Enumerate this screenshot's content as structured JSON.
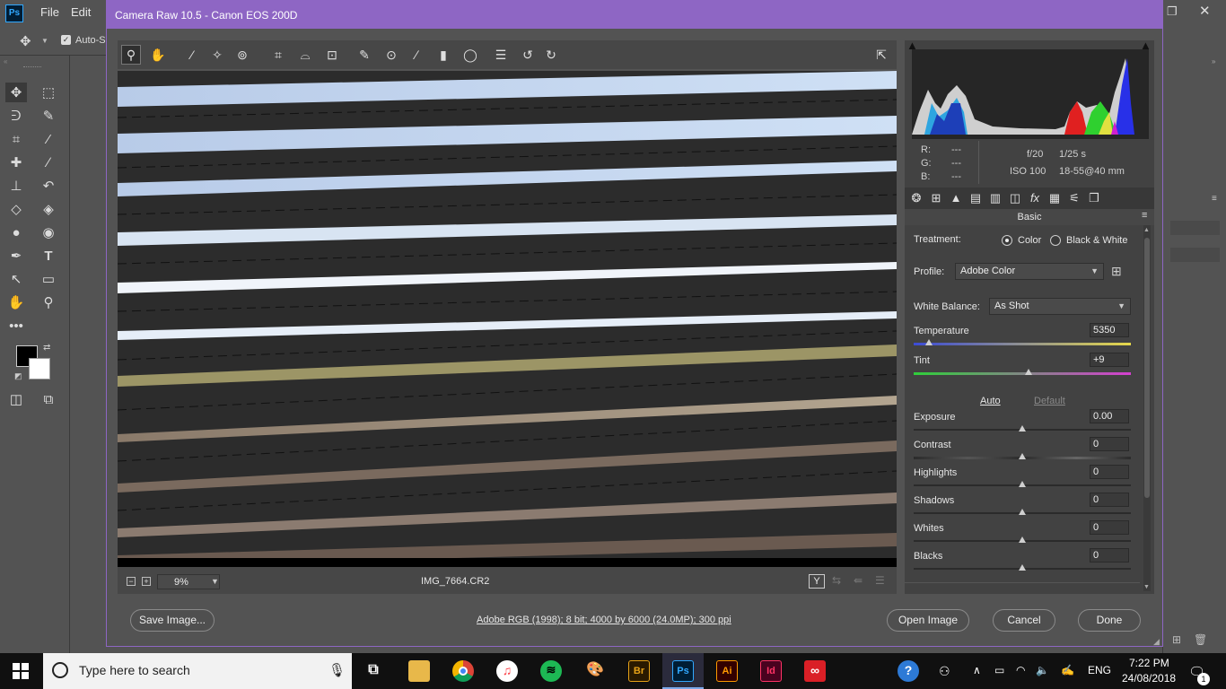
{
  "ps": {
    "logo": "Ps",
    "menus": [
      "File",
      "Edit"
    ],
    "options_label": "Auto-Se"
  },
  "acr": {
    "title": "Camera Raw 10.5  -  Canon EOS 200D",
    "readout": {
      "r_label": "R:",
      "g_label": "G:",
      "b_label": "B:",
      "r_val": "---",
      "g_val": "---",
      "b_val": "---",
      "aperture": "f/20",
      "shutter": "1/25 s",
      "iso": "ISO 100",
      "lens": "18-55@40 mm"
    },
    "panel_title": "Basic",
    "treatment": {
      "label": "Treatment:",
      "option_color": "Color",
      "option_bw": "Black & White",
      "selected": "Color"
    },
    "profile": {
      "label": "Profile:",
      "value": "Adobe Color"
    },
    "white_balance": {
      "label": "White Balance:",
      "value": "As Shot"
    },
    "auto_label": "Auto",
    "default_label": "Default",
    "sliders": {
      "temperature": {
        "label": "Temperature",
        "value": "5350",
        "min": 2000,
        "max": 50000,
        "num": 5350
      },
      "tint": {
        "label": "Tint",
        "value": "+9",
        "min": -150,
        "max": 150,
        "num": 9
      },
      "exposure": {
        "label": "Exposure",
        "value": "0.00",
        "min": -5,
        "max": 5,
        "num": 0
      },
      "contrast": {
        "label": "Contrast",
        "value": "0",
        "min": -100,
        "max": 100,
        "num": 0
      },
      "highlights": {
        "label": "Highlights",
        "value": "0",
        "min": -100,
        "max": 100,
        "num": 0
      },
      "shadows": {
        "label": "Shadows",
        "value": "0",
        "min": -100,
        "max": 100,
        "num": 0
      },
      "whites": {
        "label": "Whites",
        "value": "0",
        "min": -100,
        "max": 100,
        "num": 0
      },
      "blacks": {
        "label": "Blacks",
        "value": "0",
        "min": -100,
        "max": 100,
        "num": 0
      }
    },
    "zoom": "9%",
    "filename": "IMG_7664.CR2",
    "workflow_link": "Adobe RGB (1998); 8 bit; 4000 by 6000 (24.0MP); 300 ppi",
    "buttons": {
      "save": "Save Image...",
      "open": "Open Image",
      "cancel": "Cancel",
      "done": "Done"
    }
  },
  "taskbar": {
    "search_placeholder": "Type here to search",
    "apps": [
      "Br",
      "Ps",
      "Ai",
      "Id"
    ],
    "language": "ENG",
    "time": "7:22 PM",
    "date": "24/08/2018",
    "notification_count": "1"
  },
  "colors": {
    "title_bar": "#8e66c4",
    "temperature_gradient": [
      "#3b4bd6",
      "#e6d84a"
    ],
    "tint_gradient": [
      "#2fcf3a",
      "#d53fd0"
    ]
  }
}
